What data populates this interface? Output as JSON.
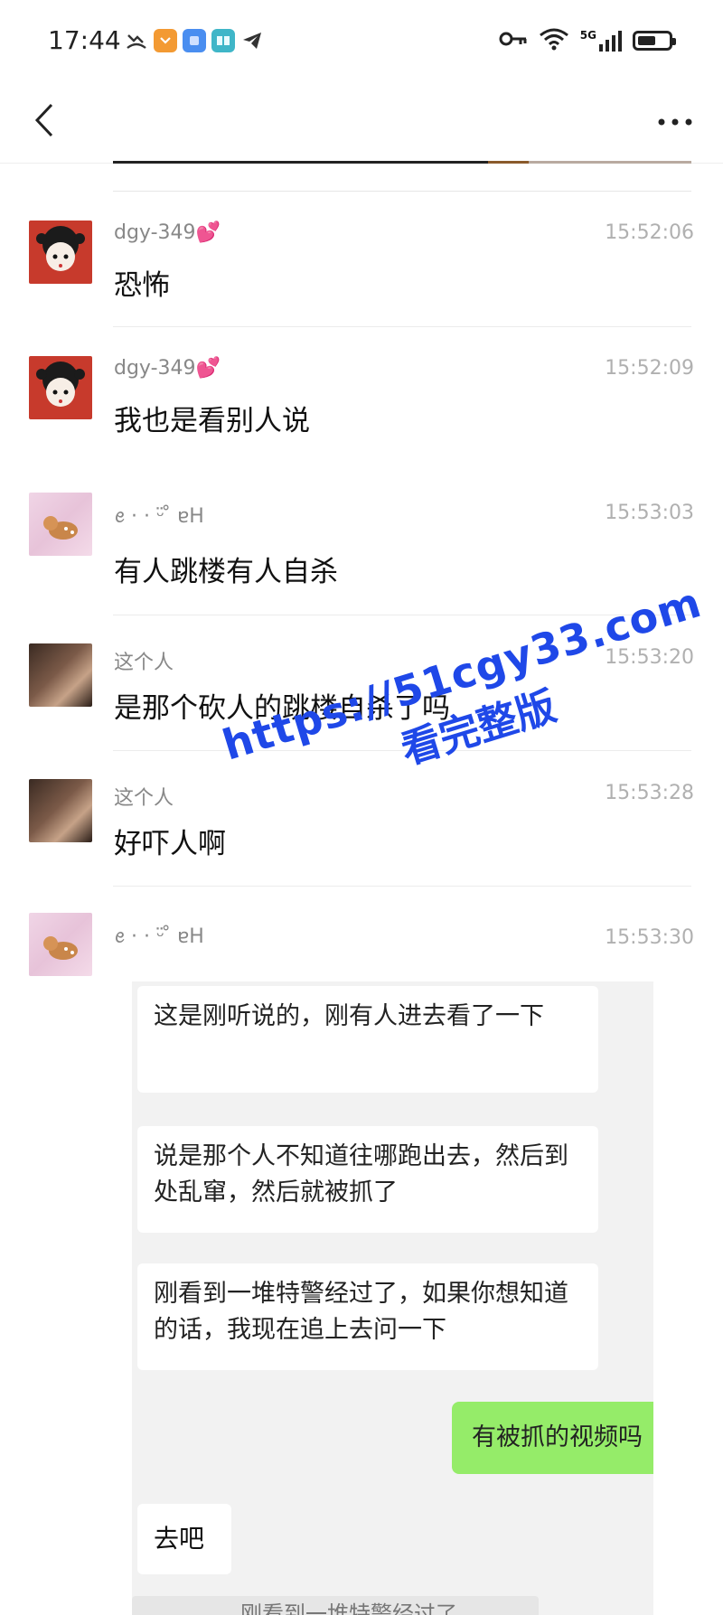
{
  "status_bar": {
    "time": "17:44",
    "notification_icons": [
      "missed-call-icon",
      "shield-app-icon",
      "square-app-icon",
      "book-app-icon",
      "telegram-icon"
    ],
    "system_icons": [
      "key-icon",
      "wifi-icon",
      "5g-signal-icon",
      "battery-icon"
    ],
    "network": "5G",
    "battery_level": 0.6
  },
  "nav": {
    "back_icon": "chevron-left-icon",
    "more_icon": "more-dots-icon"
  },
  "messages": [
    {
      "sender": "dgy-349💕",
      "time": "15:52:06",
      "text": "恐怖",
      "avatar": "cartoon-girl-avatar"
    },
    {
      "sender": "dgy-349💕",
      "time": "15:52:09",
      "text": "我也是看别人说",
      "avatar": "cartoon-girl-avatar"
    },
    {
      "sender": "ꫀ · · ᵕ̈ ̊ ɐH",
      "time": "15:53:03",
      "text": "有人跳楼有人自杀",
      "avatar": "fawn-avatar"
    },
    {
      "sender": "这个人",
      "time": "15:53:20",
      "text": "是那个砍人的跳楼自杀了吗",
      "avatar": "couple-photo-avatar"
    },
    {
      "sender": "这个人",
      "time": "15:53:28",
      "text": "好吓人啊",
      "avatar": "couple-photo-avatar"
    },
    {
      "sender": "ꫀ · · ᵕ̈ ̊ ɐH",
      "time": "15:53:30",
      "text": "",
      "avatar": "fawn-avatar"
    }
  ],
  "forwarded": {
    "bubbles": [
      "这是刚听说的，刚有人进去看了一下",
      "说是那个人不知道往哪跑出去，然后到处乱窜，然后就被抓了",
      "刚看到一堆特警经过了，如果你想知道的话，我现在追上去问一下"
    ],
    "green_bubble": "有被抓的视频吗",
    "short_reply": "去吧",
    "quote": "刚看到一堆特警经过了"
  },
  "watermark": {
    "url": "https://51cgy33.com",
    "subtitle": "看完整版",
    "color": "#1f48e8"
  },
  "colors": {
    "green_bubble": "#95ec69",
    "background": "#ffffff"
  }
}
